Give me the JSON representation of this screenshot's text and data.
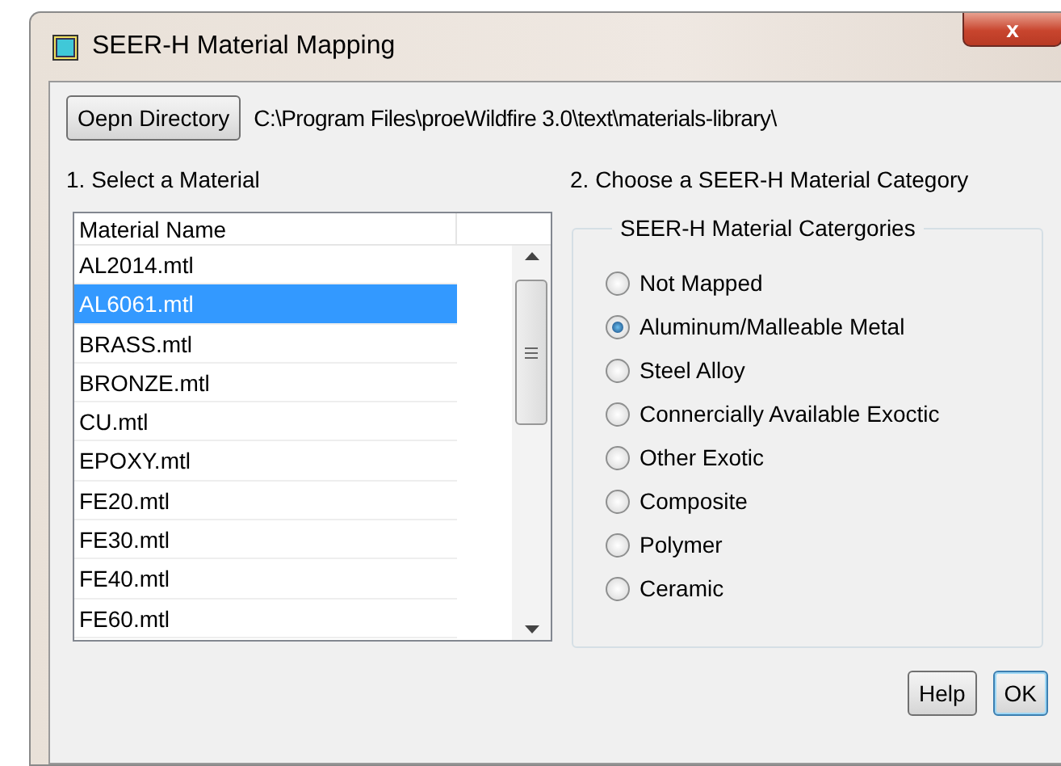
{
  "window": {
    "title": "SEER-H Material Mapping",
    "close": "x"
  },
  "directory": {
    "button": "Oepn Directory",
    "path": "C:\\Program Files\\proeWildfire 3.0\\text\\materials-library\\"
  },
  "material_section": {
    "label": "1. Select a Material",
    "column": "Material Name",
    "rows": [
      {
        "name": "AL2014.mtl",
        "selected": false
      },
      {
        "name": "AL6061.mtl",
        "selected": true
      },
      {
        "name": "BRASS.mtl",
        "selected": false
      },
      {
        "name": "BRONZE.mtl",
        "selected": false
      },
      {
        "name": "CU.mtl",
        "selected": false
      },
      {
        "name": "EPOXY.mtl",
        "selected": false
      },
      {
        "name": "FE20.mtl",
        "selected": false
      },
      {
        "name": "FE30.mtl",
        "selected": false
      },
      {
        "name": "FE40.mtl",
        "selected": false
      },
      {
        "name": "FE60.mtl",
        "selected": false
      }
    ]
  },
  "category_section": {
    "label": "2. Choose a SEER-H Material Category",
    "group_title": "SEER-H Material Catergories",
    "options": [
      {
        "label": "Not Mapped",
        "selected": false
      },
      {
        "label": "Aluminum/Malleable Metal",
        "selected": true
      },
      {
        "label": "Steel Alloy",
        "selected": false
      },
      {
        "label": "Connercially Available Exoctic",
        "selected": false
      },
      {
        "label": "Other Exotic",
        "selected": false
      },
      {
        "label": "Composite",
        "selected": false
      },
      {
        "label": "Polymer",
        "selected": false
      },
      {
        "label": "Ceramic",
        "selected": false
      }
    ]
  },
  "buttons": [
    {
      "label": "Help",
      "default": false
    },
    {
      "label": "OK",
      "default": true
    }
  ]
}
